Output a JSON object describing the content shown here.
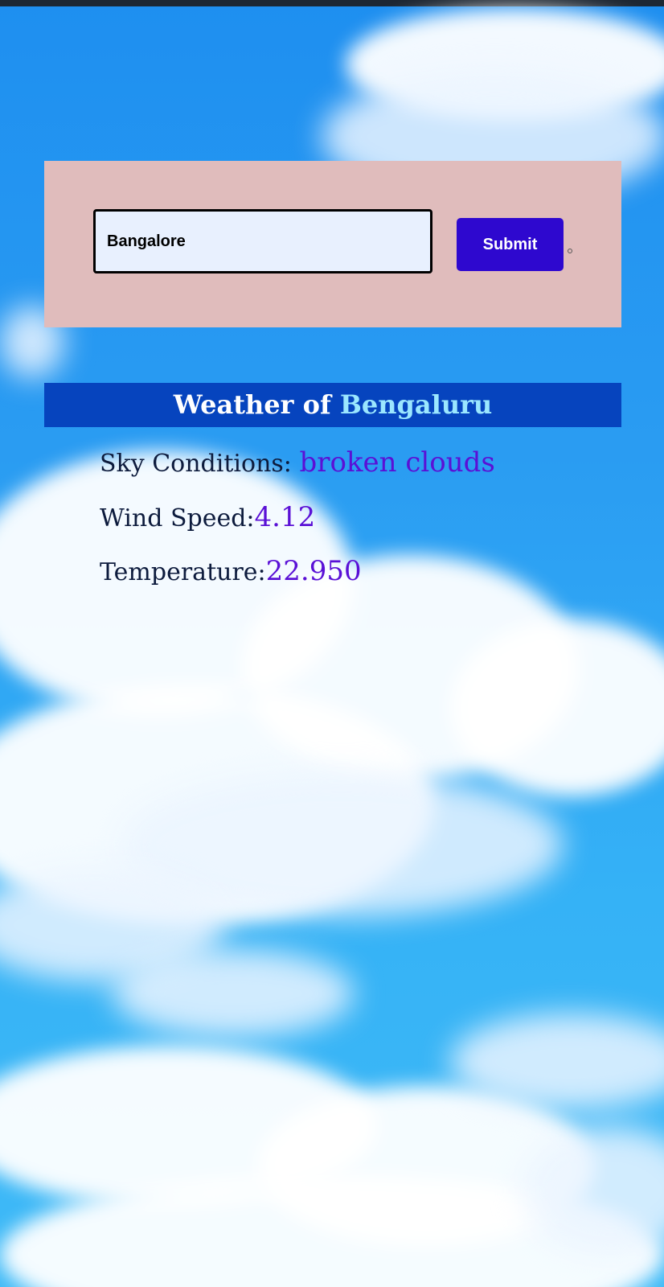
{
  "form": {
    "city_value": "Bangalore",
    "submit_label": "Submit"
  },
  "weather": {
    "title_prefix": "Weather of ",
    "city": "Bengaluru",
    "sky_label": "Sky Conditions: ",
    "sky_value": "broken clouds",
    "wind_label": "Wind Speed:",
    "wind_value": "4.12",
    "temp_label": "Temperature:",
    "temp_value": "22.950"
  },
  "colors": {
    "form_panel": "#e0bcbc",
    "submit_button": "#2e08cf",
    "title_bar": "#0644be",
    "title_city": "#9be7ff",
    "value_text": "#5a10d6",
    "label_text": "#0d1b3d"
  },
  "background": "sky-with-clouds"
}
